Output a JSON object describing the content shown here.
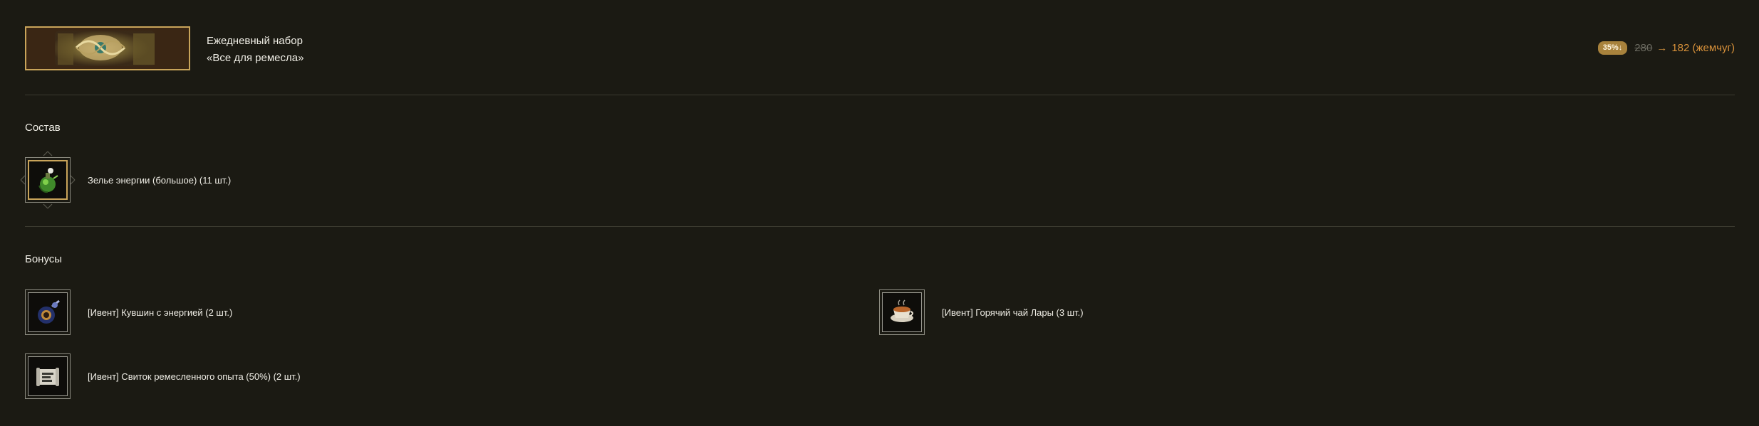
{
  "header": {
    "bundle_line1": "Ежедневный набор",
    "bundle_line2": "«Все для ремесла»",
    "discount": "35%↓",
    "old_price": "280",
    "arrow": "→",
    "new_price": "182 (жемчуг)"
  },
  "composition": {
    "title": "Состав",
    "items": [
      {
        "label": "Зелье энергии (большое) (11 шт.)",
        "icon": "green-potion-icon"
      }
    ]
  },
  "bonuses": {
    "title": "Бонусы",
    "items": [
      {
        "label": "[Ивент] Кувшин с энергией (2 шт.)",
        "icon": "energy-jug-icon"
      },
      {
        "label": "[Ивент] Горячий чай Лары (3 шт.)",
        "icon": "tea-cup-icon"
      },
      {
        "label": "[Ивент] Свиток ремесленного опыта (50%) (2 шт.)",
        "icon": "scroll-icon"
      }
    ]
  },
  "colors": {
    "background": "#1b1a13",
    "accent_gold": "#c9a45a",
    "price_orange": "#d8913a",
    "badge": "#a8823c"
  }
}
